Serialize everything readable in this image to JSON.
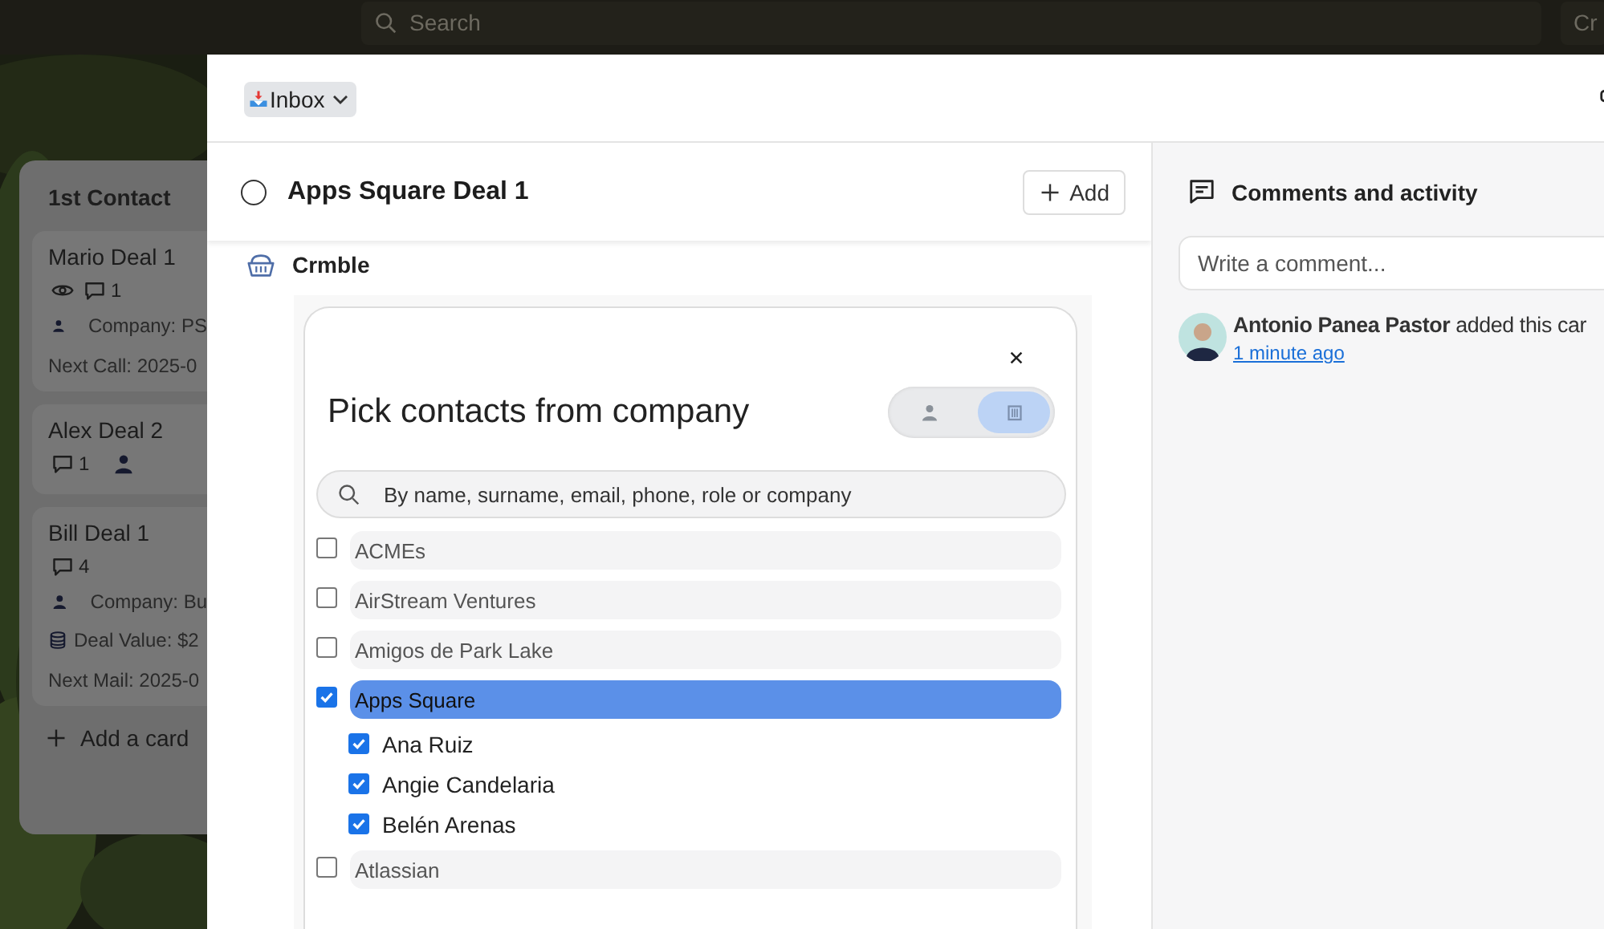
{
  "top_bar": {
    "search": {
      "placeholder": "Search"
    },
    "button": "Cr"
  },
  "board": {
    "list": {
      "title": "1st Contact",
      "add_card": "Add a card",
      "cards": [
        {
          "title": "Mario Deal 1",
          "badges": [
            {
              "kind": "watch"
            },
            {
              "kind": "comments",
              "text": "1"
            }
          ],
          "fields": [
            {
              "kind": "company",
              "text": "Company: PS"
            },
            {
              "kind": "date",
              "text": "Next Call: 2025-0"
            }
          ]
        },
        {
          "title": "Alex Deal 2",
          "badges": [
            {
              "kind": "comments",
              "text": "1"
            },
            {
              "kind": "member"
            }
          ]
        },
        {
          "title": "Bill Deal 1",
          "badges": [
            {
              "kind": "comments",
              "text": "4"
            }
          ],
          "fields": [
            {
              "kind": "company",
              "text": "Company: Bu"
            },
            {
              "kind": "value",
              "text": "Deal Value: $2"
            },
            {
              "kind": "date",
              "text": "Next Mail: 2025-0"
            }
          ]
        }
      ]
    }
  },
  "card_modal": {
    "list_menu": "Inbox",
    "title": "Apps Square Deal 1",
    "add_button": "Add",
    "section": "Crmble",
    "picker": {
      "title": "Pick contacts from company",
      "modes": [
        {
          "kind": "person",
          "selected": false
        },
        {
          "kind": "company",
          "selected": true
        }
      ],
      "search": {
        "placeholder": "By name, surname, email, phone, role or company"
      },
      "companies": [
        {
          "name": "ACMEs",
          "checked": false,
          "selected": false
        },
        {
          "name": "AirStream Ventures",
          "checked": false,
          "selected": false
        },
        {
          "name": "Amigos de Park Lake",
          "checked": false,
          "selected": false
        },
        {
          "name": "Apps Square",
          "checked": true,
          "selected": true,
          "children": [
            {
              "name": "Ana Ruiz",
              "checked": true
            },
            {
              "name": "Angie Candelaria",
              "checked": true
            },
            {
              "name": "Belén Arenas",
              "checked": true
            }
          ]
        },
        {
          "name": "Atlassian",
          "checked": false,
          "selected": false
        }
      ]
    },
    "activity": {
      "title": "Comments and activity",
      "comment_field": {
        "placeholder": "Write a comment..."
      },
      "entries": [
        {
          "text": "**Antonio Panea Pastor** added this car",
          "time": "1 minute ago"
        }
      ]
    }
  }
}
